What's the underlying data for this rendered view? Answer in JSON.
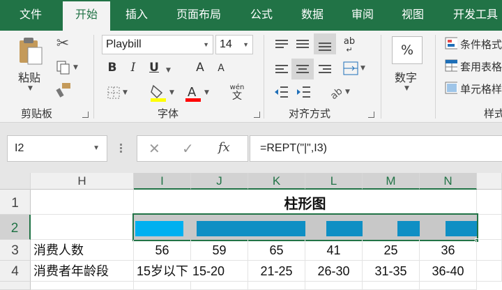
{
  "tabs": [
    "文件",
    "开始",
    "插入",
    "页面布局",
    "公式",
    "数据",
    "审阅",
    "视图",
    "开发工具"
  ],
  "active_tab": "开始",
  "ribbon": {
    "clipboard": {
      "label": "剪贴板",
      "paste": "粘贴"
    },
    "font": {
      "label": "字体",
      "name": "Playbill",
      "size": "14",
      "bold": "B",
      "italic": "I",
      "underline": "U",
      "grow": "A",
      "shrink": "A",
      "phonetic_top": "wén",
      "phonetic_bottom": "文"
    },
    "alignment": {
      "label": "对齐方式",
      "wrap_text": "ab"
    },
    "number": {
      "label": "数字",
      "percent": "%"
    },
    "styles": {
      "label": "样式",
      "conditional": "条件格式",
      "table": "套用表格",
      "cell": "单元格样"
    }
  },
  "formula_bar": {
    "name_box": "I2",
    "fx": "fx",
    "formula": "=REPT(\"|\",I3)"
  },
  "sheet": {
    "columns": [
      "H",
      "I",
      "J",
      "K",
      "L",
      "M",
      "N"
    ],
    "rows": [
      "1",
      "2",
      "3",
      "4"
    ],
    "title": "柱形图",
    "row3_label": "消费人数",
    "row4_label": "消费者年龄段",
    "values": [
      56,
      59,
      65,
      41,
      25,
      36
    ],
    "age_groups": [
      "15岁以下",
      "15-20",
      "21-25",
      "26-30",
      "31-35",
      "36-40"
    ],
    "bar_colors": {
      "first": "#00b0f0",
      "rest": "#0f8fc4",
      "background": "#c8c8c8"
    }
  }
}
